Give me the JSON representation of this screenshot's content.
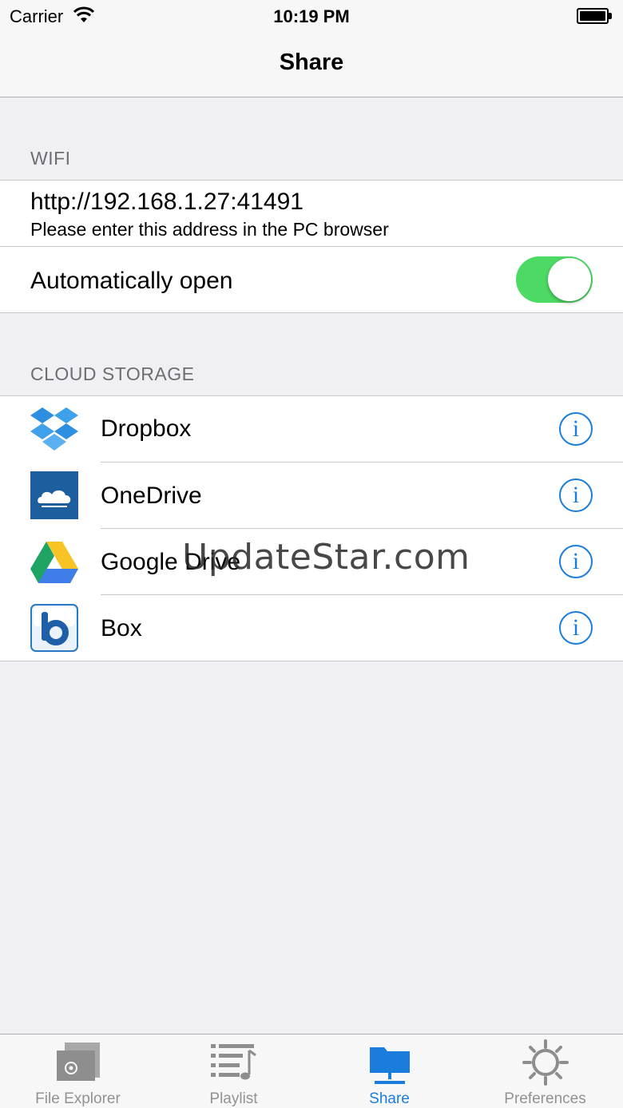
{
  "status_bar": {
    "carrier": "Carrier",
    "time": "10:19 PM",
    "battery_level": 1.0
  },
  "nav": {
    "title": "Share"
  },
  "wifi": {
    "header": "WIFI",
    "address": "http://192.168.1.27:41491",
    "hint": "Please enter this address in the PC browser",
    "auto_open_label": "Automatically open",
    "auto_open_on": true
  },
  "cloud": {
    "header": "CLOUD STORAGE",
    "items": [
      {
        "label": "Dropbox",
        "icon": "dropbox-icon"
      },
      {
        "label": "OneDrive",
        "icon": "onedrive-icon"
      },
      {
        "label": "Google Drive",
        "icon": "google-drive-icon"
      },
      {
        "label": "Box",
        "icon": "box-icon"
      }
    ],
    "info_glyph": "i"
  },
  "watermark": "UpdateStar.com",
  "tabs": [
    {
      "label": "File Explorer",
      "icon": "file-explorer-icon",
      "active": false
    },
    {
      "label": "Playlist",
      "icon": "playlist-icon",
      "active": false
    },
    {
      "label": "Share",
      "icon": "share-folder-icon",
      "active": true
    },
    {
      "label": "Preferences",
      "icon": "preferences-gear-icon",
      "active": false
    }
  ],
  "colors": {
    "accent": "#1a7ddb",
    "toggle_on": "#4cd964",
    "background": "#efeff4",
    "tab_inactive": "#929292"
  }
}
